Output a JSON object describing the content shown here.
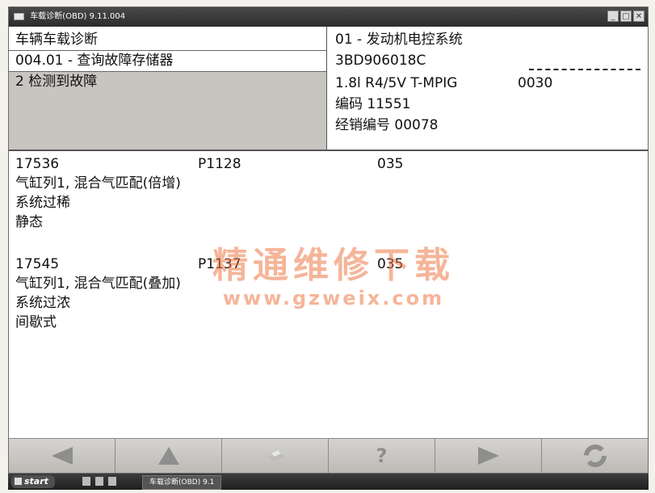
{
  "window": {
    "title": "车载诊断(OBD) 9.11.004"
  },
  "header": {
    "left": {
      "line1": "车辆车载诊断",
      "line2": "004.01 - 查询故障存储器",
      "status": "2 检测到故障"
    },
    "right": {
      "system": "01 - 发动机电控系统",
      "part_no": "3BD906018C",
      "engine": "1.8l R4/5V T-MPIG",
      "engine_code": "0030",
      "coding": "编码 11551",
      "dealer": "经销编号 00078"
    }
  },
  "faults": [
    {
      "code": "17536",
      "pcode": "P1128",
      "count": "035",
      "line1": "气缸列1, 混合气匹配(倍增)",
      "line2": "系统过稀",
      "line3": "静态"
    },
    {
      "code": "17545",
      "pcode": "P1137",
      "count": "035",
      "line1": "气缸列1, 混合气匹配(叠加)",
      "line2": "系统过浓",
      "line3": "间歇式"
    }
  ],
  "watermark": {
    "text": "精通维修下载",
    "url": "www.gzweix.com"
  },
  "toolbar": {
    "help_label": "?"
  },
  "taskbar": {
    "start_label": "start",
    "task_label": "车载诊断(OBD) 9.1"
  },
  "colors": {
    "status_bg": "#c8c5c1",
    "watermark": "#ec7846",
    "toolbar_icon": "#8e8e8e"
  }
}
